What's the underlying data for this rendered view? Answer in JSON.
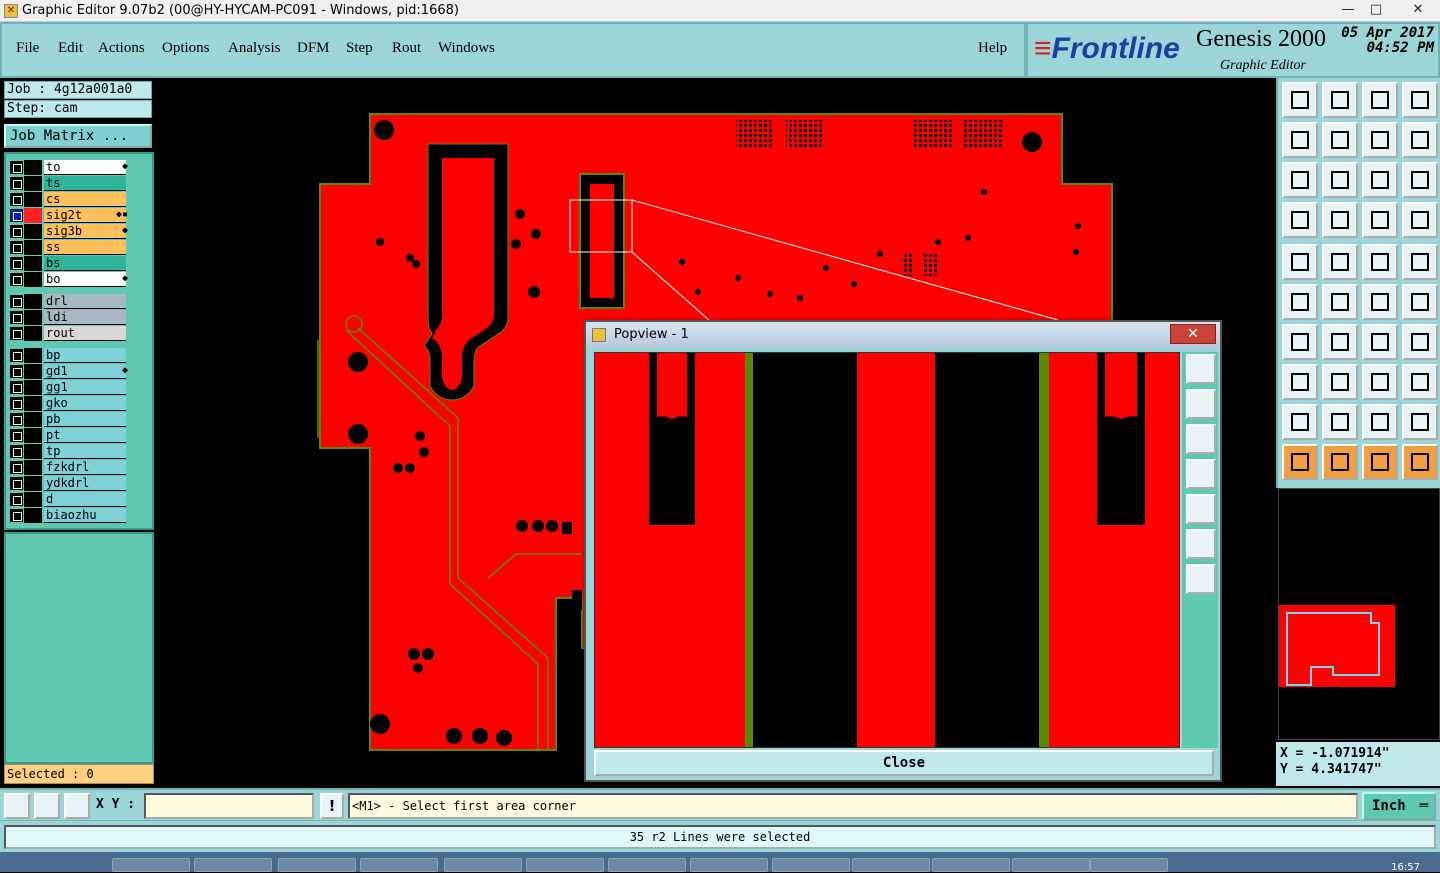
{
  "window": {
    "title": "Graphic Editor 9.07b2 (00@HY-HYCAM-PC091 - Windows, pid:1668)",
    "minimize": "—",
    "maximize": "□",
    "close": "✕"
  },
  "menu": {
    "items": [
      "File",
      "Edit",
      "Actions",
      "Options",
      "Analysis",
      "DFM",
      "Step",
      "Rout",
      "Windows"
    ],
    "help": "Help"
  },
  "brand": {
    "logo": "Frontline",
    "product": "Genesis 2000",
    "subtitle": "Graphic Editor",
    "date": "05 Apr 2017",
    "time": "04:52 PM"
  },
  "job": {
    "job_line": "Job : 4g12a001a0",
    "step_line": "Step: cam",
    "matrix_button": "Job Matrix ..."
  },
  "layers": [
    {
      "name": "to",
      "color": "#ffffff",
      "mark": "◆"
    },
    {
      "name": "ts",
      "color": "#2fb39a",
      "mark": ""
    },
    {
      "name": "cs",
      "color": "#ffc060",
      "mark": ""
    },
    {
      "name": "sig2t",
      "color": "#ffc060",
      "mark": "◆▪",
      "active": true
    },
    {
      "name": "sig3b",
      "color": "#ffc060",
      "mark": "◆"
    },
    {
      "name": "ss",
      "color": "#ffc060",
      "mark": ""
    },
    {
      "name": "bs",
      "color": "#2fb39a",
      "mark": ""
    },
    {
      "name": "bo",
      "color": "#ffffff",
      "mark": "◆"
    },
    {
      "name": "drl",
      "color": "#a8b8c0",
      "mark": ""
    },
    {
      "name": "ldi",
      "color": "#a8b8c0",
      "mark": ""
    },
    {
      "name": "rout",
      "color": "#d8d8d8",
      "mark": ""
    },
    {
      "name": "bp",
      "color": "#7fd0d8",
      "mark": ""
    },
    {
      "name": "gd1",
      "color": "#7fd0d8",
      "mark": "◆"
    },
    {
      "name": "gg1",
      "color": "#7fd0d8",
      "mark": ""
    },
    {
      "name": "gko",
      "color": "#7fd0d8",
      "mark": ""
    },
    {
      "name": "pb",
      "color": "#7fd0d8",
      "mark": ""
    },
    {
      "name": "pt",
      "color": "#7fd0d8",
      "mark": ""
    },
    {
      "name": "tp",
      "color": "#7fd0d8",
      "mark": ""
    },
    {
      "name": "fzkdrl",
      "color": "#7fd0d8",
      "mark": ""
    },
    {
      "name": "ydkdrl",
      "color": "#7fd0d8",
      "mark": ""
    },
    {
      "name": "d",
      "color": "#7fd0d8",
      "mark": ""
    },
    {
      "name": "biaozhu",
      "color": "#7fd0d8",
      "mark": ""
    }
  ],
  "selected": "Selected : 0",
  "popview": {
    "title": "Popview - 1",
    "close_x": "✕",
    "close_button": "Close"
  },
  "coords": {
    "x": "X = -1.071914\"",
    "y": "Y = 4.341747\""
  },
  "command": {
    "xy_label": "X Y :",
    "xy_value": "",
    "info_button": "!",
    "prompt": "<M1> - Select first area corner",
    "unit": "Inch"
  },
  "status": "35 r2 Lines were selected",
  "clock": "16:57",
  "colors": {
    "board": "#ff0000",
    "copper_edge": "#5a8a00",
    "panel": "#9bd5d8"
  }
}
